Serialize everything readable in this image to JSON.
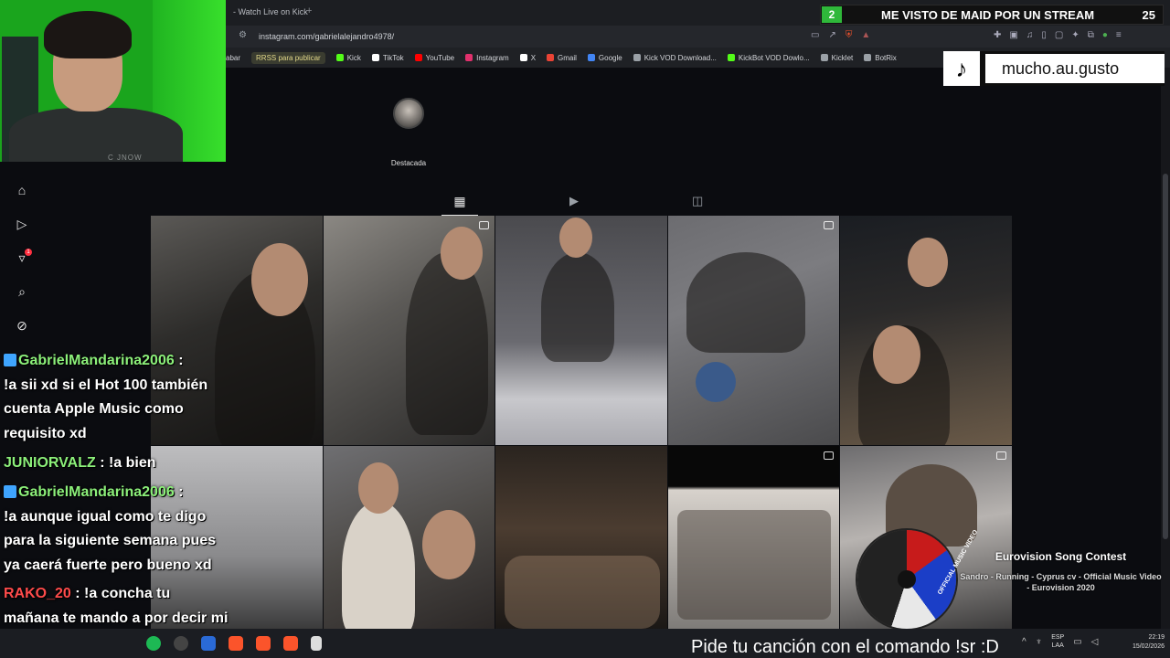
{
  "browser": {
    "tab_title": "- Watch Live on Kick",
    "tab_plus": "+",
    "url": "instagram.com/gabrielalejandro4978/",
    "bookmarks": [
      {
        "label": "abar",
        "color": "#555"
      },
      {
        "label": "RRSS para publicar",
        "color": "#e3d98a"
      },
      {
        "label": "Kick",
        "color": "#53fc18"
      },
      {
        "label": "TikTok",
        "color": "#ffffff"
      },
      {
        "label": "YouTube",
        "color": "#ff0000"
      },
      {
        "label": "Instagram",
        "color": "#e1306c"
      },
      {
        "label": "X",
        "color": "#ffffff"
      },
      {
        "label": "Gmail",
        "color": "#ea4335"
      },
      {
        "label": "Google",
        "color": "#4285f4"
      },
      {
        "label": "Kick VOD Download...",
        "color": "#9aa0a6"
      },
      {
        "label": "KickBot VOD Dowlo...",
        "color": "#53fc18"
      },
      {
        "label": "Kicklet",
        "color": "#9aa0a6"
      },
      {
        "label": "BotRix",
        "color": "#9aa0a6"
      }
    ]
  },
  "profile": {
    "highlight_label": "Destacada",
    "tabs": [
      "posts-grid",
      "reels",
      "tagged"
    ]
  },
  "posts": [
    {
      "type": "photo"
    },
    {
      "type": "reel"
    },
    {
      "type": "photo"
    },
    {
      "type": "reel"
    },
    {
      "type": "photo"
    },
    {
      "type": "photo"
    },
    {
      "type": "photo"
    },
    {
      "type": "photo"
    },
    {
      "type": "reel"
    },
    {
      "type": "reel"
    }
  ],
  "sidebar": {
    "items": [
      "home-icon",
      "reels-icon",
      "activity-icon",
      "search-icon",
      "explore-icon"
    ],
    "notification_count": "1"
  },
  "overlay": {
    "song_rank": "2",
    "song_title": "ME VISTO DE MAID POR UN STREAM",
    "song_count": "25",
    "tiktok_handle": "mucho.au.gusto",
    "cam_shirt": "C JNOW"
  },
  "chat": [
    {
      "user": "GabrielMandarina2006",
      "text": "!a sii xd si el Hot 100 también cuenta Apple Music como requisito xd"
    },
    {
      "user": "JUNIORVALZ",
      "text": "!a bien"
    },
    {
      "user": "GabrielMandarina2006",
      "text": "!a aunque igual como te digo para la siguiente semana pues ya caerá fuerte pero bueno xd"
    },
    {
      "user": "RAKO_20",
      "text": "!a concha tu mañana te mando a por decir mi nombre"
    }
  ],
  "now_playing": {
    "artist": "Eurovision Song Contest",
    "title": "Sandro - Running - Cyprus cv - Official Music Video - Eurovision 2020",
    "disc_label": "OFFICIAL MUSIC VIDEO"
  },
  "taskbar": {
    "ticker": "Pide tu canción con el comando !sr :D",
    "lang_top": "ESP",
    "lang_bottom": "LAA",
    "time": "22:19",
    "date": "15/02/2026"
  }
}
